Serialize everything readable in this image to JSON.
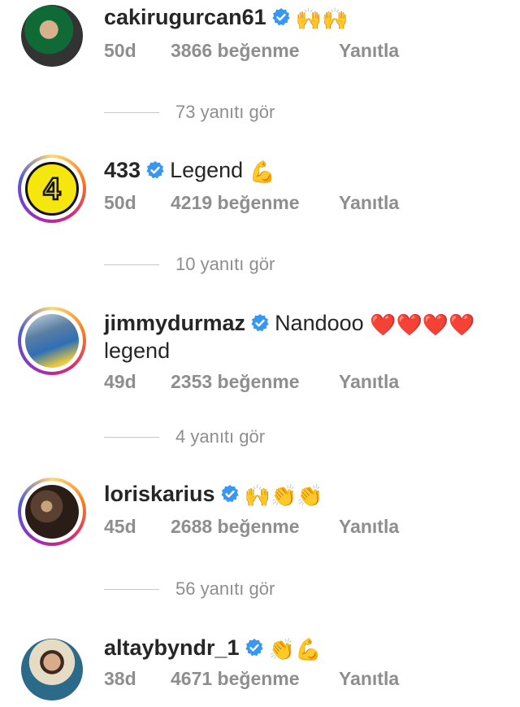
{
  "comments": [
    {
      "username": "cakirugurcan61",
      "text": "",
      "emoji": "🙌🙌",
      "time": "50d",
      "likes": "3866 beğenme",
      "reply": "Yanıtla",
      "replies": "73 yanıtı gör",
      "avatar": "photo",
      "avatar_colors": [
        "#0d5c2e",
        "#3b3b3b"
      ]
    },
    {
      "username": "433",
      "text": "Legend",
      "emoji": "💪",
      "time": "50d",
      "likes": "4219 beğenme",
      "reply": "Yanıtla",
      "replies": "10 yanıtı gör",
      "avatar": "number-4",
      "avatar_colors": [
        "#f5e60d",
        "#111111"
      ]
    },
    {
      "username": "jimmydurmaz",
      "text": "Nandooo",
      "text2": "legend",
      "emoji": "❤️❤️❤️❤️",
      "time": "49d",
      "likes": "2353 beğenme",
      "reply": "Yanıtla",
      "replies": "4 yanıtı gör",
      "avatar": "photo",
      "avatar_colors": [
        "#2f6fb5",
        "#e8c840"
      ]
    },
    {
      "username": "loriskarius",
      "text": "",
      "emoji": "🙌👏👏",
      "time": "45d",
      "likes": "2688 beğenme",
      "reply": "Yanıtla",
      "replies": "56 yanıtı gör",
      "avatar": "photo",
      "avatar_colors": [
        "#3a2a22",
        "#c9a27a"
      ]
    },
    {
      "username": "altaybyndr_1",
      "text": "",
      "emoji": "👏💪",
      "time": "38d",
      "likes": "4671 beğenme",
      "reply": "Yanıtla",
      "avatar": "photo",
      "avatar_colors": [
        "#2c6a8a",
        "#c79a7a"
      ]
    }
  ],
  "verified_icon": "verified-badge-icon",
  "colors": {
    "verified": "#3897f0",
    "muted": "#8e8e8e",
    "text": "#262626"
  }
}
